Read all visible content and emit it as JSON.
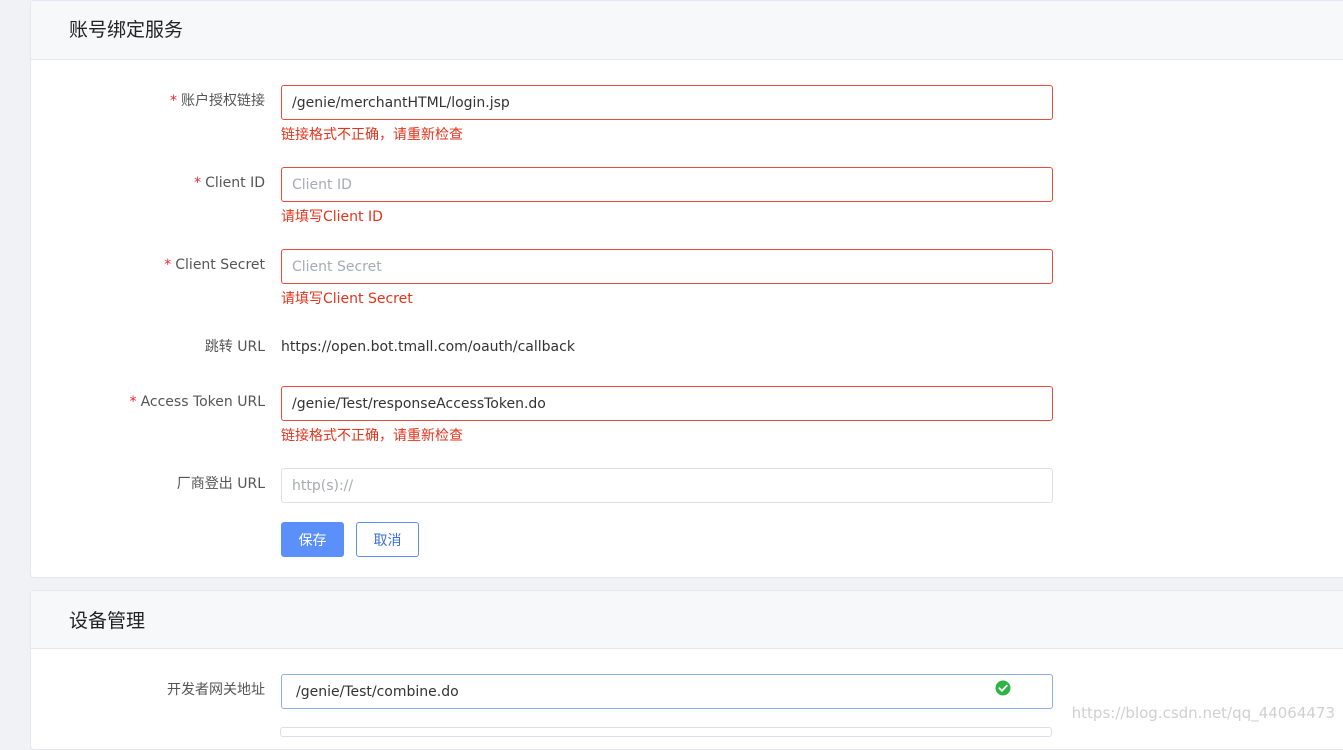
{
  "account_section": {
    "title": "账号绑定服务",
    "fields": {
      "auth_link": {
        "label": "账户授权链接",
        "value": "/genie/merchantHTML/login.jsp",
        "placeholder": "",
        "error": "链接格式不正确，请重新检查"
      },
      "client_id": {
        "label": "Client ID",
        "value": "",
        "placeholder": "Client ID",
        "error": "请填写Client ID"
      },
      "client_secret": {
        "label": "Client Secret",
        "value": "",
        "placeholder": "Client Secret",
        "error": "请填写Client Secret"
      },
      "redirect_url": {
        "label": "跳转 URL",
        "value": "https://open.bot.tmall.com/oauth/callback"
      },
      "access_token_url": {
        "label": "Access Token URL",
        "value": "/genie/Test/responseAccessToken.do",
        "placeholder": "",
        "error": "链接格式不正确，请重新检查"
      },
      "logout_url": {
        "label": "厂商登出 URL",
        "value": "",
        "placeholder": "http(s)://"
      }
    },
    "required_mark": "*",
    "save_label": "保存",
    "cancel_label": "取消"
  },
  "device_section": {
    "title": "设备管理",
    "fields": {
      "gateway": {
        "label": "开发者网关地址",
        "value": "/genie/Test/combine.do"
      }
    }
  },
  "watermark": "https://blog.csdn.net/qq_44064473",
  "colors": {
    "error": "#e2341d",
    "primary": "#5b8ff9",
    "success": "#2fb344"
  }
}
